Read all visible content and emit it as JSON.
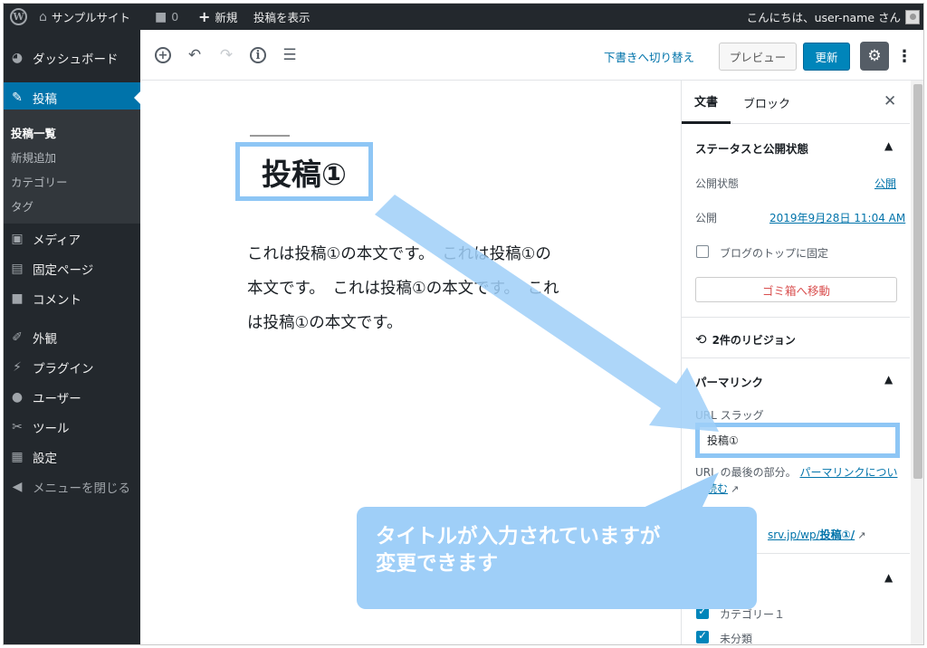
{
  "admin_bar": {
    "site_name": "サンプルサイト",
    "comments_count": "0",
    "new_label": "新規",
    "view_post_label": "投稿を表示",
    "greeting": "こんにちは、user-name さん"
  },
  "sidebar": {
    "items": [
      {
        "label": "ダッシュボード",
        "icon": "dashboard-icon"
      },
      {
        "label": "投稿",
        "icon": "pin-icon"
      },
      {
        "label": "メディア",
        "icon": "media-icon"
      },
      {
        "label": "固定ページ",
        "icon": "page-icon"
      },
      {
        "label": "コメント",
        "icon": "comment-icon"
      },
      {
        "label": "外観",
        "icon": "brush-icon"
      },
      {
        "label": "プラグイン",
        "icon": "plugin-icon"
      },
      {
        "label": "ユーザー",
        "icon": "user-icon"
      },
      {
        "label": "ツール",
        "icon": "wrench-icon"
      },
      {
        "label": "設定",
        "icon": "settings-icon"
      }
    ],
    "submenu": [
      "投稿一覧",
      "新規追加",
      "カテゴリー",
      "タグ"
    ],
    "collapse_label": "メニューを閉じる"
  },
  "toolbar": {
    "switch_to_draft": "下書きへ切り替え",
    "preview": "プレビュー",
    "update": "更新"
  },
  "editor": {
    "title": "投稿①",
    "body": "これは投稿①の本文です。　これは投稿①の本文です。　これは投稿①の本文です。　これは投稿①の本文です。"
  },
  "panel": {
    "tab_document": "文書",
    "tab_block": "ブロック",
    "status_section": "ステータスと公開状態",
    "visibility_label": "公開状態",
    "visibility_value": "公開",
    "publish_label": "公開",
    "publish_value": "2019年9月28日 11:04 AM",
    "stick_label": "ブログのトップに固定",
    "trash_label": "ゴミ箱へ移動",
    "revisions": "2件のリビジョン",
    "permalink_section": "パーマリンク",
    "slug_label": "URL スラッグ",
    "slug_value": "投稿①",
    "slug_help_prefix": "URL の最後の部分。",
    "slug_help_link": "パーマリンクについて読む",
    "url_tail_prefix": "srv.jp/wp/",
    "url_tail_bold": "投稿①/",
    "categories": [
      "カテゴリー１",
      "未分類"
    ]
  },
  "annotation": {
    "callout_line1": "タイトルが入力されていますが",
    "callout_line2": "変更できます"
  },
  "colors": {
    "admin_dark": "#23282d",
    "accent_blue": "#0073aa",
    "highlight_blue": "#8ec6f5",
    "callout_blue": "#9fcff8"
  }
}
